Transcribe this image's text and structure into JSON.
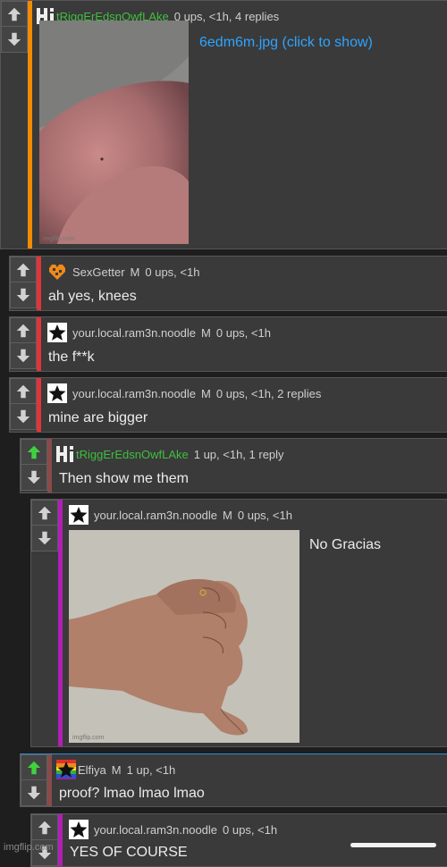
{
  "colors": {
    "orange_bar": "#f08c00",
    "red_bar": "#e0343a",
    "brown_bar": "#8a4a4a",
    "magenta_bar": "#b21fb5",
    "blue_bar": "#2b8fd6",
    "green_user": "#3fbf3f",
    "link": "#2fa4ff",
    "upvoted": "#3fd13f"
  },
  "comments": [
    {
      "username": "tRiggErEdsnOwfLAke",
      "meta": "0 ups, <1h, 4 replies",
      "image_link": "6edm6m.jpg (click to show)",
      "photo_watermark": "imgflip.com"
    },
    {
      "username": "SexGetter",
      "badge": "M",
      "meta": "0 ups, <1h",
      "text": "ah yes, knees"
    },
    {
      "username": "your.local.ram3n.noodle",
      "badge": "M",
      "meta": "0 ups, <1h",
      "text": "the f**k"
    },
    {
      "username": "your.local.ram3n.noodle",
      "badge": "M",
      "meta": "0 ups, <1h, 2 replies",
      "text": "mine are bigger"
    },
    {
      "username": "tRiggErEdsnOwfLAke",
      "meta": "1 up, <1h, 1 reply",
      "text": "Then show me them"
    },
    {
      "username": "your.local.ram3n.noodle",
      "badge": "M",
      "meta": "0 ups, <1h",
      "text": "No Gracias",
      "photo_watermark": "imgflip.com"
    },
    {
      "username": "Elfiya",
      "badge": "M",
      "meta": "1 up, <1h",
      "text": "proof? lmao lmao lmao"
    },
    {
      "username": "your.local.ram3n.noodle",
      "meta": "0 ups, <1h",
      "text": "YES OF COURSE"
    }
  ],
  "footer": {
    "watermark": "imgflip.com"
  }
}
